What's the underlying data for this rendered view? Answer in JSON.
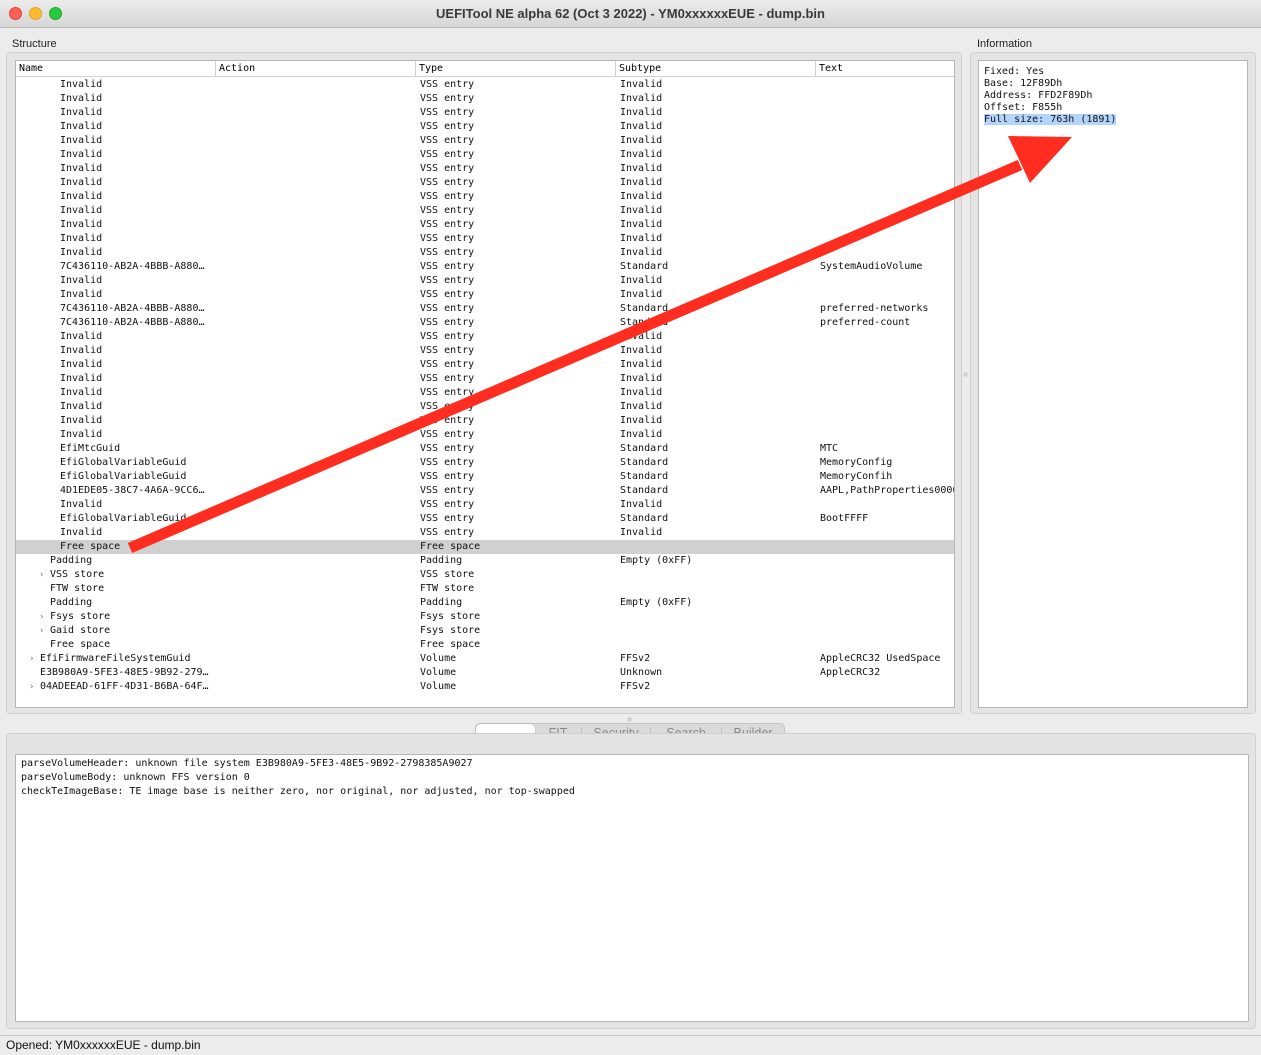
{
  "window": {
    "title": "UEFITool NE alpha 62 (Oct  3 2022) - YM0xxxxxxEUE - dump.bin"
  },
  "structure": {
    "label": "Structure",
    "columns": [
      "Name",
      "Action",
      "Type",
      "Subtype",
      "Text"
    ],
    "rows": [
      {
        "indent": 4,
        "expander": false,
        "name": "Invalid",
        "type": "VSS entry",
        "subtype": "Invalid",
        "text": ""
      },
      {
        "indent": 4,
        "expander": false,
        "name": "Invalid",
        "type": "VSS entry",
        "subtype": "Invalid",
        "text": ""
      },
      {
        "indent": 4,
        "expander": false,
        "name": "Invalid",
        "type": "VSS entry",
        "subtype": "Invalid",
        "text": ""
      },
      {
        "indent": 4,
        "expander": false,
        "name": "Invalid",
        "type": "VSS entry",
        "subtype": "Invalid",
        "text": ""
      },
      {
        "indent": 4,
        "expander": false,
        "name": "Invalid",
        "type": "VSS entry",
        "subtype": "Invalid",
        "text": ""
      },
      {
        "indent": 4,
        "expander": false,
        "name": "Invalid",
        "type": "VSS entry",
        "subtype": "Invalid",
        "text": ""
      },
      {
        "indent": 4,
        "expander": false,
        "name": "Invalid",
        "type": "VSS entry",
        "subtype": "Invalid",
        "text": ""
      },
      {
        "indent": 4,
        "expander": false,
        "name": "Invalid",
        "type": "VSS entry",
        "subtype": "Invalid",
        "text": ""
      },
      {
        "indent": 4,
        "expander": false,
        "name": "Invalid",
        "type": "VSS entry",
        "subtype": "Invalid",
        "text": ""
      },
      {
        "indent": 4,
        "expander": false,
        "name": "Invalid",
        "type": "VSS entry",
        "subtype": "Invalid",
        "text": ""
      },
      {
        "indent": 4,
        "expander": false,
        "name": "Invalid",
        "type": "VSS entry",
        "subtype": "Invalid",
        "text": ""
      },
      {
        "indent": 4,
        "expander": false,
        "name": "Invalid",
        "type": "VSS entry",
        "subtype": "Invalid",
        "text": ""
      },
      {
        "indent": 4,
        "expander": false,
        "name": "Invalid",
        "type": "VSS entry",
        "subtype": "Invalid",
        "text": ""
      },
      {
        "indent": 4,
        "expander": false,
        "name": "7C436110-AB2A-4BBB-A880…",
        "type": "VSS entry",
        "subtype": "Standard",
        "text": "SystemAudioVolume"
      },
      {
        "indent": 4,
        "expander": false,
        "name": "Invalid",
        "type": "VSS entry",
        "subtype": "Invalid",
        "text": ""
      },
      {
        "indent": 4,
        "expander": false,
        "name": "Invalid",
        "type": "VSS entry",
        "subtype": "Invalid",
        "text": ""
      },
      {
        "indent": 4,
        "expander": false,
        "name": "7C436110-AB2A-4BBB-A880…",
        "type": "VSS entry",
        "subtype": "Standard",
        "text": "preferred-networks"
      },
      {
        "indent": 4,
        "expander": false,
        "name": "7C436110-AB2A-4BBB-A880…",
        "type": "VSS entry",
        "subtype": "Standard",
        "text": "preferred-count"
      },
      {
        "indent": 4,
        "expander": false,
        "name": "Invalid",
        "type": "VSS entry",
        "subtype": "Invalid",
        "text": ""
      },
      {
        "indent": 4,
        "expander": false,
        "name": "Invalid",
        "type": "VSS entry",
        "subtype": "Invalid",
        "text": ""
      },
      {
        "indent": 4,
        "expander": false,
        "name": "Invalid",
        "type": "VSS entry",
        "subtype": "Invalid",
        "text": ""
      },
      {
        "indent": 4,
        "expander": false,
        "name": "Invalid",
        "type": "VSS entry",
        "subtype": "Invalid",
        "text": ""
      },
      {
        "indent": 4,
        "expander": false,
        "name": "Invalid",
        "type": "VSS entry",
        "subtype": "Invalid",
        "text": ""
      },
      {
        "indent": 4,
        "expander": false,
        "name": "Invalid",
        "type": "VSS entry",
        "subtype": "Invalid",
        "text": ""
      },
      {
        "indent": 4,
        "expander": false,
        "name": "Invalid",
        "type": "VSS entry",
        "subtype": "Invalid",
        "text": ""
      },
      {
        "indent": 4,
        "expander": false,
        "name": "Invalid",
        "type": "VSS entry",
        "subtype": "Invalid",
        "text": ""
      },
      {
        "indent": 4,
        "expander": false,
        "name": "EfiMtcGuid",
        "type": "VSS entry",
        "subtype": "Standard",
        "text": "MTC"
      },
      {
        "indent": 4,
        "expander": false,
        "name": "EfiGlobalVariableGuid",
        "type": "VSS entry",
        "subtype": "Standard",
        "text": "MemoryConfig"
      },
      {
        "indent": 4,
        "expander": false,
        "name": "EfiGlobalVariableGuid",
        "type": "VSS entry",
        "subtype": "Standard",
        "text": "MemoryConfih"
      },
      {
        "indent": 4,
        "expander": false,
        "name": "4D1EDE05-38C7-4A6A-9CC6…",
        "type": "VSS entry",
        "subtype": "Standard",
        "text": "AAPL,PathProperties0000"
      },
      {
        "indent": 4,
        "expander": false,
        "name": "Invalid",
        "type": "VSS entry",
        "subtype": "Invalid",
        "text": ""
      },
      {
        "indent": 4,
        "expander": false,
        "name": "EfiGlobalVariableGuid",
        "type": "VSS entry",
        "subtype": "Standard",
        "text": "BootFFFF"
      },
      {
        "indent": 4,
        "expander": false,
        "name": "Invalid",
        "type": "VSS entry",
        "subtype": "Invalid",
        "text": ""
      },
      {
        "indent": 4,
        "expander": false,
        "name": "Free space",
        "type": "Free space",
        "subtype": "",
        "text": "",
        "selected": true
      },
      {
        "indent": 3,
        "expander": false,
        "name": "Padding",
        "type": "Padding",
        "subtype": "Empty (0xFF)",
        "text": ""
      },
      {
        "indent": 3,
        "expander": true,
        "name": "VSS store",
        "type": "VSS store",
        "subtype": "",
        "text": ""
      },
      {
        "indent": 3,
        "expander": false,
        "name": "FTW store",
        "type": "FTW store",
        "subtype": "",
        "text": ""
      },
      {
        "indent": 3,
        "expander": false,
        "name": "Padding",
        "type": "Padding",
        "subtype": "Empty (0xFF)",
        "text": ""
      },
      {
        "indent": 3,
        "expander": true,
        "name": "Fsys store",
        "type": "Fsys store",
        "subtype": "",
        "text": ""
      },
      {
        "indent": 3,
        "expander": true,
        "name": "Gaid store",
        "type": "Fsys store",
        "subtype": "",
        "text": ""
      },
      {
        "indent": 3,
        "expander": false,
        "name": "Free space",
        "type": "Free space",
        "subtype": "",
        "text": ""
      },
      {
        "indent": 2,
        "expander": true,
        "name": "EfiFirmwareFileSystemGuid",
        "type": "Volume",
        "subtype": "FFSv2",
        "text": "AppleCRC32 UsedSpace"
      },
      {
        "indent": 2,
        "expander": false,
        "name": "E3B980A9-5FE3-48E5-9B92-279…",
        "type": "Volume",
        "subtype": "Unknown",
        "text": "AppleCRC32"
      },
      {
        "indent": 2,
        "expander": true,
        "name": "04ADEEAD-61FF-4D31-B6BA-64F…",
        "type": "Volume",
        "subtype": "FFSv2",
        "text": ""
      }
    ]
  },
  "information": {
    "label": "Information",
    "lines": [
      {
        "text": "Fixed: Yes",
        "highlight": false
      },
      {
        "text": "Base: 12F89Dh",
        "highlight": false
      },
      {
        "text": "Address: FFD2F89Dh",
        "highlight": false
      },
      {
        "text": "Offset: F855h",
        "highlight": false
      },
      {
        "text": "Full size: 763h (1891)",
        "highlight": true
      }
    ]
  },
  "tabs": [
    {
      "label": "",
      "active": true
    },
    {
      "label": "FIT",
      "active": false
    },
    {
      "label": "Security",
      "active": false
    },
    {
      "label": "Search",
      "active": false
    },
    {
      "label": "Builder",
      "active": false
    }
  ],
  "messages": [
    "parseVolumeHeader: unknown file system E3B980A9-5FE3-48E5-9B92-2798385A9027",
    "parseVolumeBody: unknown FFS version 0",
    "checkTeImageBase: TE image base is neither zero, nor original, nor adjusted, nor top-swapped"
  ],
  "status": {
    "text": "Opened: YM0xxxxxxEUE - dump.bin"
  },
  "colors": {
    "arrow": "#ff2d1f",
    "selection": "#d0d0d0",
    "info_highlight": "#b3d4fc"
  }
}
